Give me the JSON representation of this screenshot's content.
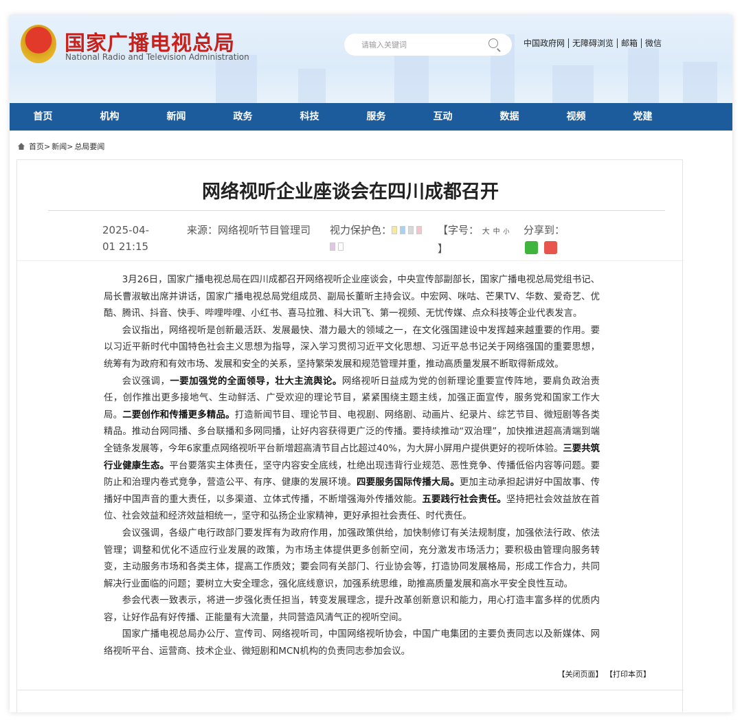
{
  "header": {
    "title_cn": "国家广播电视总局",
    "title_en": "National Radio and Television Administration",
    "search_placeholder": "请输入关键词",
    "links": [
      "中国政府网",
      "无障碍浏览",
      "邮箱",
      "微信"
    ]
  },
  "nav": [
    "首页",
    "机构",
    "新闻",
    "政务",
    "科技",
    "服务",
    "互动",
    "数据",
    "视频",
    "党建"
  ],
  "breadcrumb": [
    "首页>",
    "新闻>",
    "总局要闻"
  ],
  "article": {
    "title": "网络视听企业座谈会在四川成都召开",
    "date_line1": "2025-04-",
    "date_line2": "01 21:15",
    "source": "来源：网络视听节目管理司",
    "eye_label": "视力保护色：",
    "font_open": "【字号：",
    "font_sizes": [
      "大",
      "中",
      "小"
    ],
    "font_close": "】",
    "share_label": "分享到：",
    "eye_colors": [
      "#f7eaa0",
      "#a9d2f2",
      "#d8d8d8",
      "#f3c6cf",
      "#e2c6e6",
      "#ffffff"
    ],
    "p1": "3月26日，国家广播电视总局在四川成都召开网络视听企业座谈会，中央宣传部副部长，国家广播电视总局党组书记、局长曹淑敏出席并讲话，国家广播电视总局党组成员、副局长董昕主持会议。中宏网、咪咕、芒果TV、华数、爱奇艺、优酷、腾讯、抖音、快手、哔哩哔哩、小红书、喜马拉雅、科大讯飞、第一视频、无忧传媒、点众科技等企业代表发言。",
    "p2": "会议指出，网络视听是创新最活跃、发展最快、潜力最大的领域之一，在文化强国建设中发挥越来越重要的作用。要以习近平新时代中国特色社会主义思想为指导，深入学习贯彻习近平文化思想、习近平总书记关于网络强国的重要思想，统筹有为政府和有效市场、发展和安全的关系，坚持繁荣发展和规范管理并重，推动高质量发展不断取得新成效。",
    "p3": [
      "会议强调，",
      "一要加强党的全面领导，壮大主流舆论。",
      "网络视听日益成为党的创新理论重要宣传阵地，要肩负政治责任，创作推出更多接地气、生动鲜活、广受欢迎的理论节目，紧紧围绕主题主线，加强正面宣传，服务党和国家工作大局。",
      "二要创作和传播更多精品。",
      "打造新闻节目、理论节目、电视剧、网络剧、动画片、纪录片、综艺节目、微短剧等各类精品。推动台网同播、多台联播和多网同播，让好内容获得更广泛的传播。要持续推动“双治理”，加快推进超高清端到端全链条发展等，今年6家重点网络视听平台新增超高清节目占比超过40%，为大屏小屏用户提供更好的视听体验。",
      "三要共筑行业健康生态。",
      "平台要落实主体责任，坚守内容安全底线，杜绝出现违背行业规范、恶性竞争、传播低俗内容等问题。要防止和治理内卷式竞争，营造公平、有序、健康的发展环境。",
      "四要服务国际传播大局。",
      "更加主动承担起讲好中国故事、传播好中国声音的重大责任，以多渠道、立体式传播，不断增强海外传播效能。",
      "五要践行社会责任。",
      "坚持把社会效益放在首位、社会效益和经济效益相统一，坚守和弘扬企业家精神，更好承担社会责任、时代责任。"
    ],
    "p4": "会议强调，各级广电行政部门要发挥有为政府作用，加强政策供给，加快制修订有关法规制度，加强依法行政、依法管理；调整和优化不适应行业发展的政策，为市场主体提供更多创新空间，充分激发市场活力；要积极由管理向服务转变，主动服务市场和各类主体，提高工作质效；要会同有关部门、行业协会等，打造协同发展格局，形成工作合力，共同解决行业面临的问题；要树立大安全理念，强化底线意识，加强系统思维，助推高质量发展和高水平安全良性互动。",
    "p5": "参会代表一致表示，将进一步强化责任担当，转变发展理念，提升改革创新意识和能力，用心打造丰富多样的优质内容，让好作品有好传播、正能量有大流量，共同营造风清气正的视听空间。",
    "p6": "国家广播电视总局办公厅、宣传司、网络视听司，中国网络视听协会，中国广电集团的主要负责同志以及新媒体、网络视听平台、运营商、技术企业、微短剧和MCN机构的负责同志参加会议。",
    "close_label": "【关闭页面】",
    "print_label": "【打印本页】"
  }
}
